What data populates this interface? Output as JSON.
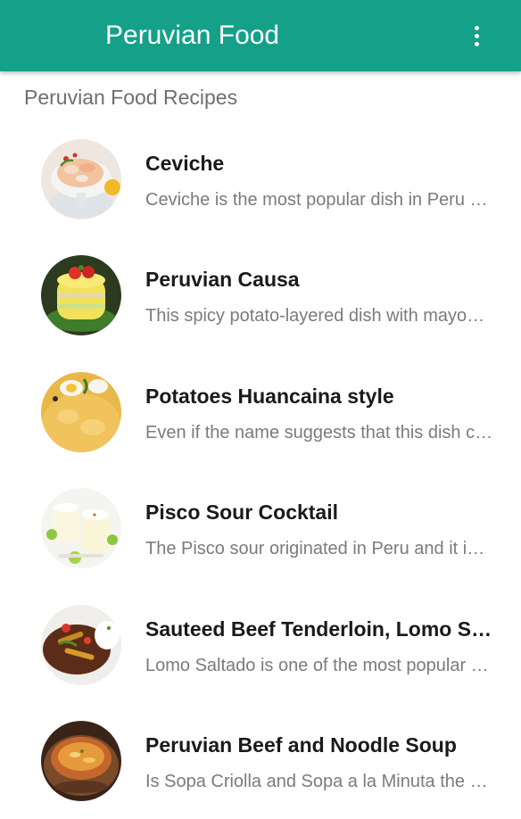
{
  "appbar": {
    "title": "Peruvian Food",
    "color": "#15a08a",
    "menu_icon": "more-vert-icon"
  },
  "section_header": "Peruvian Food Recipes",
  "recipes": [
    {
      "title": "Ceviche",
      "description": "Ceviche is the most popular dish in Peru and it is prepared with fresh fish",
      "image": "ceviche-thumbnail"
    },
    {
      "title": "Peruvian Causa",
      "description": "This spicy potato-layered dish with mayonnaise and chicken",
      "image": "causa-thumbnail"
    },
    {
      "title": "Potatoes Huancaina style",
      "description": "Even if the name suggests that this dish comes from Huancayo",
      "image": "huancaina-thumbnail"
    },
    {
      "title": "Pisco Sour Cocktail",
      "description": "The Pisco sour originated in Peru and it is the national drink",
      "image": "pisco-sour-thumbnail"
    },
    {
      "title": "Sauteed Beef Tenderloin, Lomo Saltado",
      "description": "Lomo Saltado is one of the most popular Peruvian dishes",
      "image": "lomo-saltado-thumbnail"
    },
    {
      "title": "Peruvian Beef and Noodle Soup",
      "description": "Is Sopa Criolla and Sopa a la Minuta the same soup",
      "image": "sopa-criolla-thumbnail"
    }
  ]
}
